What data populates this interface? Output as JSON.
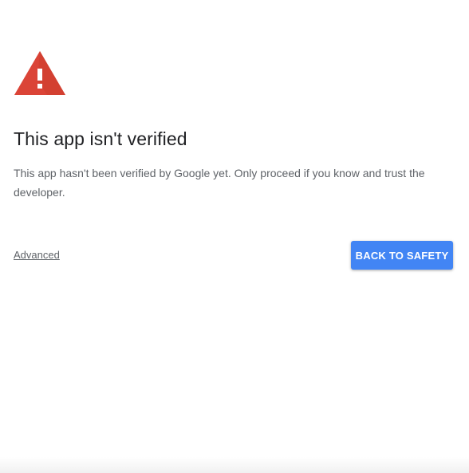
{
  "warning": {
    "icon": "warning-triangle-icon",
    "color": "#db4437"
  },
  "title": "This app isn't verified",
  "description": "This app hasn't been verified by Google yet. Only proceed if you know and trust the developer.",
  "actions": {
    "advanced_label": "Advanced",
    "back_label": "BACK TO SAFETY",
    "back_color": "#4285f4"
  }
}
